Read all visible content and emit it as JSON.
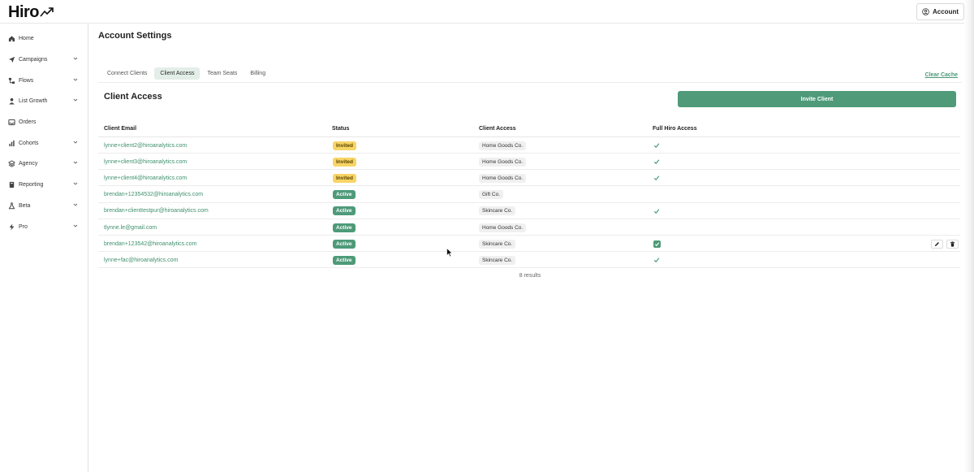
{
  "brand": {
    "name": "Hiro"
  },
  "header": {
    "account_label": "Account"
  },
  "sidebar": {
    "items": [
      {
        "label": "Home",
        "icon": "home-icon",
        "has_chevron": false
      },
      {
        "label": "Campaigns",
        "icon": "send-icon",
        "has_chevron": true
      },
      {
        "label": "Flows",
        "icon": "flow-icon",
        "has_chevron": true
      },
      {
        "label": "List Growth",
        "icon": "person-icon",
        "has_chevron": true
      },
      {
        "label": "Orders",
        "icon": "inbox-icon",
        "has_chevron": false
      },
      {
        "label": "Cohorts",
        "icon": "bar-chart-icon",
        "has_chevron": true
      },
      {
        "label": "Agency",
        "icon": "layers-icon",
        "has_chevron": true
      },
      {
        "label": "Reporting",
        "icon": "book-icon",
        "has_chevron": true
      },
      {
        "label": "Beta",
        "icon": "flask-icon",
        "has_chevron": true
      },
      {
        "label": "Pro",
        "icon": "bolt-icon",
        "has_chevron": true
      }
    ]
  },
  "main": {
    "title": "Account Settings",
    "tabs": [
      {
        "label": "Connect Clients",
        "active": false
      },
      {
        "label": "Client Access",
        "active": true
      },
      {
        "label": "Team Seats",
        "active": false
      },
      {
        "label": "Billing",
        "active": false
      }
    ],
    "clear_cache_label": "Clear Cache",
    "section_title": "Client Access",
    "invite_label": "Invite Client",
    "table": {
      "headers": [
        "Client Email",
        "Status",
        "Client Access",
        "Full Hiro Access"
      ],
      "rows": [
        {
          "email": "lynne+client2@hiroanalytics.com",
          "status": "Invited",
          "access": "Home Goods Co.",
          "full": true,
          "hovered": false
        },
        {
          "email": "lynne+client3@hiroanalytics.com",
          "status": "Invited",
          "access": "Home Goods Co.",
          "full": true,
          "hovered": false
        },
        {
          "email": "lynne+client4@hiroanalytics.com",
          "status": "Invited",
          "access": "Home Goods Co.",
          "full": true,
          "hovered": false
        },
        {
          "email": "brendan+12354532@hiroanalytics.com",
          "status": "Active",
          "access": "Gift Co.",
          "full": false,
          "hovered": false
        },
        {
          "email": "brendan+clienttestpur@hiroanalytics.com",
          "status": "Active",
          "access": "Skincare Co.",
          "full": true,
          "hovered": false
        },
        {
          "email": "tlynne.le@gmail.com",
          "status": "Active",
          "access": "Home Goods Co.",
          "full": false,
          "hovered": false
        },
        {
          "email": "brendan+123542@hiroanalytics.com",
          "status": "Active",
          "access": "Skincare Co.",
          "full": true,
          "hovered": true
        },
        {
          "email": "lynne+fac@hiroanalytics.com",
          "status": "Active",
          "access": "Skincare Co.",
          "full": true,
          "hovered": false
        }
      ]
    },
    "results_label": "8 results"
  },
  "colors": {
    "accent": "#4e9a79",
    "invited": "#f7d566",
    "tab_active": "#e3eee8"
  }
}
